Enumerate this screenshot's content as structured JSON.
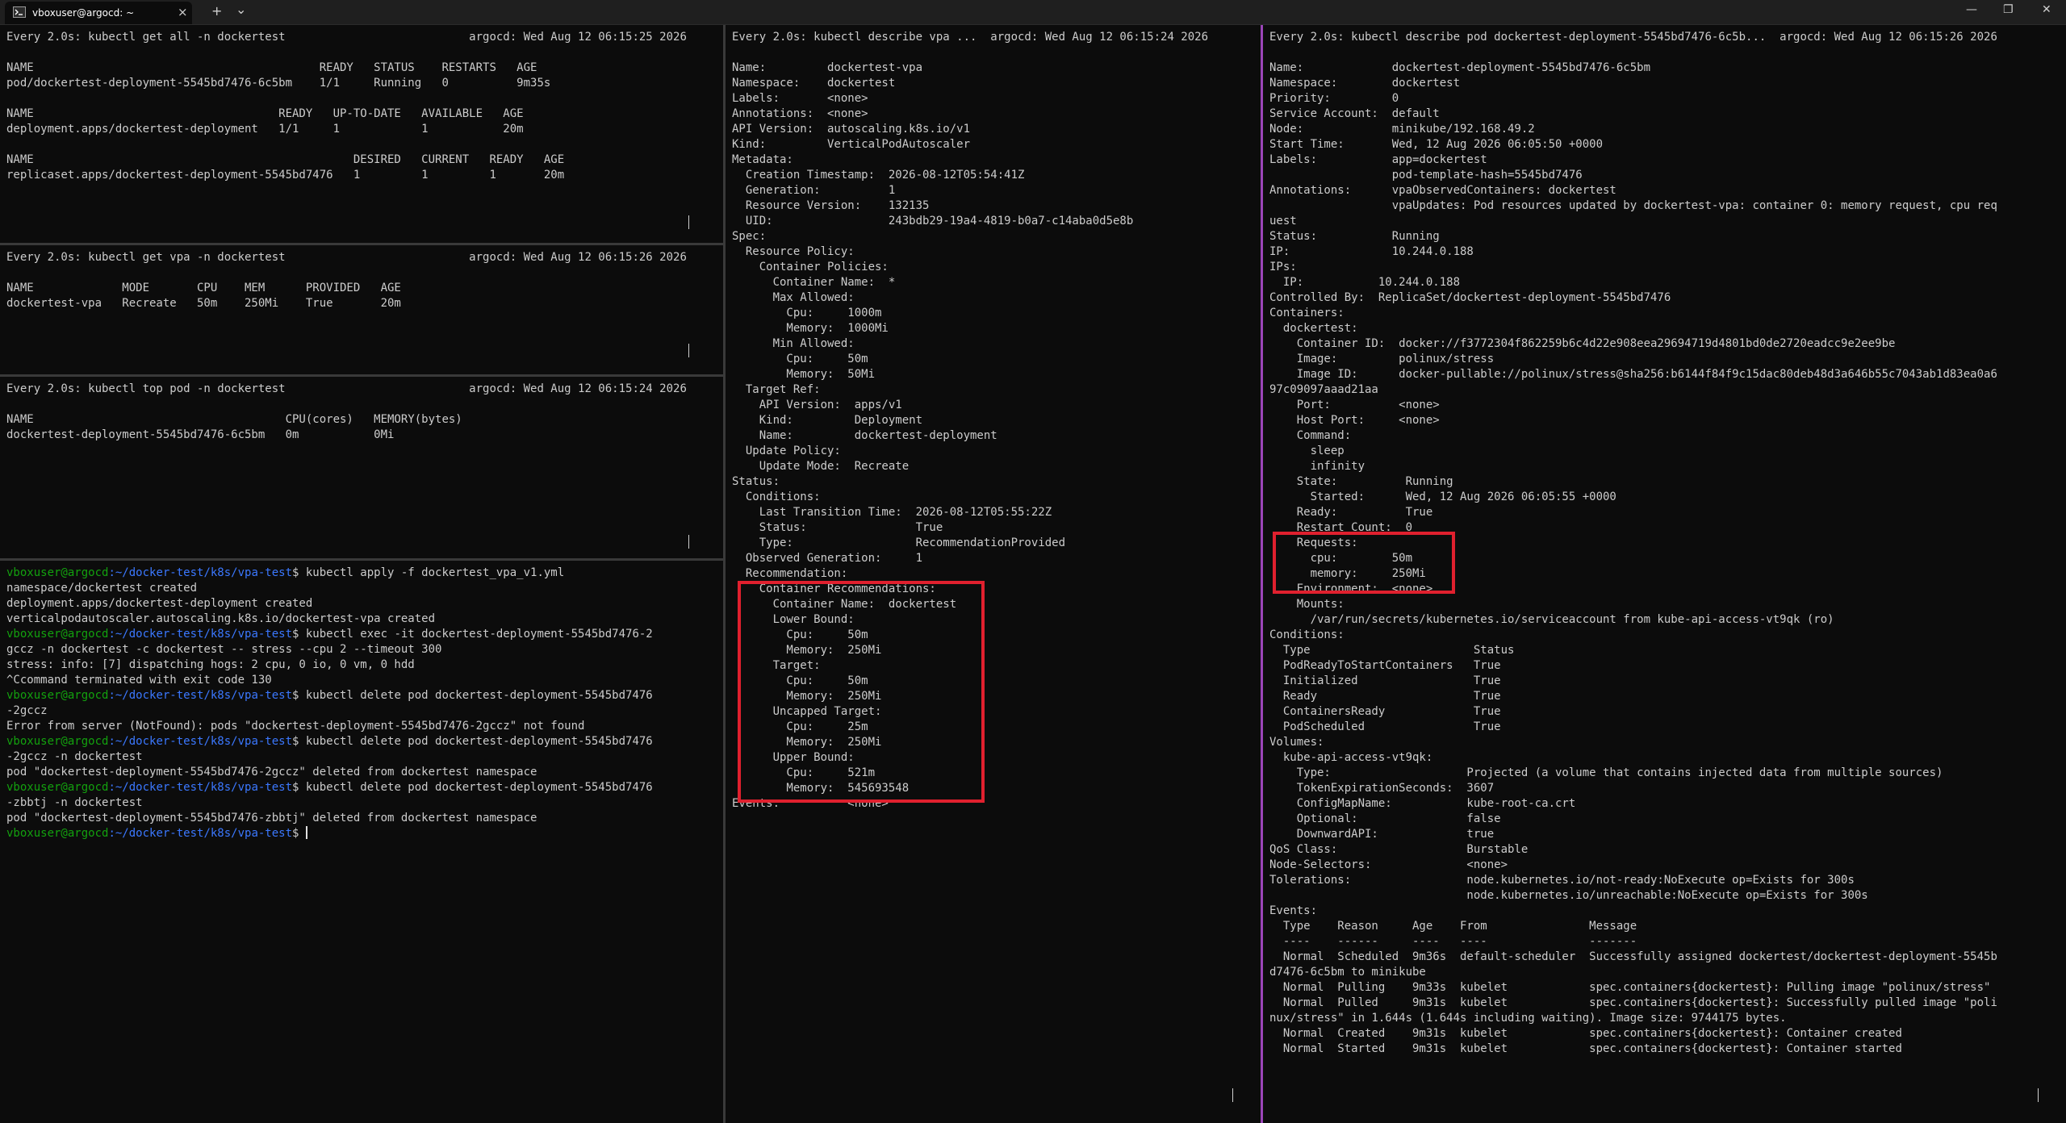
{
  "window": {
    "tab_title": "vboxuser@argocd: ~",
    "tab_close": "×",
    "new_tab": "+",
    "tab_dropdown": "⌄",
    "minimize": "—",
    "maximize": "❐",
    "close": "✕"
  },
  "pane1": {
    "text": "Every 2.0s: kubectl get all -n dockertest                           argocd: Wed Aug 12 06:15:25 2026\n\nNAME                                          READY   STATUS    RESTARTS   AGE\npod/dockertest-deployment-5545bd7476-6c5bm    1/1     Running   0          9m35s\n\nNAME                                    READY   UP-TO-DATE   AVAILABLE   AGE\ndeployment.apps/dockertest-deployment   1/1     1            1           20m\n\nNAME                                               DESIRED   CURRENT   READY   AGE\nreplicaset.apps/dockertest-deployment-5545bd7476   1         1         1       20m"
  },
  "pane2": {
    "text": "Every 2.0s: kubectl get vpa -n dockertest                           argocd: Wed Aug 12 06:15:26 2026\n\nNAME             MODE       CPU    MEM      PROVIDED   AGE\ndockertest-vpa   Recreate   50m    250Mi    True       20m"
  },
  "pane3": {
    "text": "Every 2.0s: kubectl top pod -n dockertest                           argocd: Wed Aug 12 06:15:24 2026\n\nNAME                                     CPU(cores)   MEMORY(bytes)\ndockertest-deployment-5545bd7476-6c5bm   0m           0Mi"
  },
  "shell": {
    "user": "vboxuser@argocd",
    "path": ":~/docker-test/k8s/vpa-test",
    "cmd1": "$ kubectl apply -f dockertest_vpa_v1.yml",
    "out1": "namespace/dockertest created\ndeployment.apps/dockertest-deployment created\nverticalpodautoscaler.autoscaling.k8s.io/dockertest-vpa created",
    "cmd2": "$ kubectl exec -it dockertest-deployment-5545bd7476-2\ngccz -n dockertest -c dockertest -- stress --cpu 2 --timeout 300",
    "out2": "stress: info: [7] dispatching hogs: 2 cpu, 0 io, 0 vm, 0 hdd\n^Ccommand terminated with exit code 130",
    "cmd3": "$ kubectl delete pod dockertest-deployment-5545bd7476\n-2gccz",
    "out3": "Error from server (NotFound): pods \"dockertest-deployment-5545bd7476-2gccz\" not found",
    "cmd4": "$ kubectl delete pod dockertest-deployment-5545bd7476\n-2gccz -n dockertest",
    "out4": "pod \"dockertest-deployment-5545bd7476-2gccz\" deleted from dockertest namespace",
    "cmd5": "$ kubectl delete pod dockertest-deployment-5545bd7476\n-zbbtj -n dockertest",
    "out5": "pod \"dockertest-deployment-5545bd7476-zbbtj\" deleted from dockertest namespace",
    "cmd6": "$ "
  },
  "vpa_pane": {
    "text": "Every 2.0s: kubectl describe vpa ...  argocd: Wed Aug 12 06:15:24 2026\n\nName:         dockertest-vpa\nNamespace:    dockertest\nLabels:       <none>\nAnnotations:  <none>\nAPI Version:  autoscaling.k8s.io/v1\nKind:         VerticalPodAutoscaler\nMetadata:\n  Creation Timestamp:  2026-08-12T05:54:41Z\n  Generation:          1\n  Resource Version:    132135\n  UID:                 243bdb29-19a4-4819-b0a7-c14aba0d5e8b\nSpec:\n  Resource Policy:\n    Container Policies:\n      Container Name:  *\n      Max Allowed:\n        Cpu:     1000m\n        Memory:  1000Mi\n      Min Allowed:\n        Cpu:     50m\n        Memory:  50Mi\n  Target Ref:\n    API Version:  apps/v1\n    Kind:         Deployment\n    Name:         dockertest-deployment\n  Update Policy:\n    Update Mode:  Recreate\nStatus:\n  Conditions:\n    Last Transition Time:  2026-08-12T05:55:22Z\n    Status:                True\n    Type:                  RecommendationProvided\n  Observed Generation:     1\n  Recommendation:\n    Container Recommendations:\n      Container Name:  dockertest\n      Lower Bound:\n        Cpu:     50m\n        Memory:  250Mi\n      Target:\n        Cpu:     50m\n        Memory:  250Mi\n      Uncapped Target:\n        Cpu:     25m\n        Memory:  250Mi\n      Upper Bound:\n        Cpu:     521m\n        Memory:  545693548\nEvents:          <none>"
  },
  "pod_pane": {
    "text": "Every 2.0s: kubectl describe pod dockertest-deployment-5545bd7476-6c5b...  argocd: Wed Aug 12 06:15:26 2026\n\nName:             dockertest-deployment-5545bd7476-6c5bm\nNamespace:        dockertest\nPriority:         0\nService Account:  default\nNode:             minikube/192.168.49.2\nStart Time:       Wed, 12 Aug 2026 06:05:50 +0000\nLabels:           app=dockertest\n                  pod-template-hash=5545bd7476\nAnnotations:      vpaObservedContainers: dockertest\n                  vpaUpdates: Pod resources updated by dockertest-vpa: container 0: memory request, cpu req\nuest\nStatus:           Running\nIP:               10.244.0.188\nIPs:\n  IP:           10.244.0.188\nControlled By:  ReplicaSet/dockertest-deployment-5545bd7476\nContainers:\n  dockertest:\n    Container ID:  docker://f3772304f862259b6c4d22e908eea29694719d4801bd0de2720eadcc9e2ee9be\n    Image:         polinux/stress\n    Image ID:      docker-pullable://polinux/stress@sha256:b6144f84f9c15dac80deb48d3a646b55c7043ab1d83ea0a6\n97c09097aaad21aa\n    Port:          <none>\n    Host Port:     <none>\n    Command:\n      sleep\n      infinity\n    State:          Running\n      Started:      Wed, 12 Aug 2026 06:05:55 +0000\n    Ready:          True\n    Restart Count:  0\n    Requests:\n      cpu:        50m\n      memory:     250Mi\n    Environment:  <none>\n    Mounts:\n      /var/run/secrets/kubernetes.io/serviceaccount from kube-api-access-vt9qk (ro)\nConditions:\n  Type                        Status\n  PodReadyToStartContainers   True\n  Initialized                 True\n  Ready                       True\n  ContainersReady             True\n  PodScheduled                True\nVolumes:\n  kube-api-access-vt9qk:\n    Type:                    Projected (a volume that contains injected data from multiple sources)\n    TokenExpirationSeconds:  3607\n    ConfigMapName:           kube-root-ca.crt\n    Optional:                false\n    DownwardAPI:             true\nQoS Class:                   Burstable\nNode-Selectors:              <none>\nTolerations:                 node.kubernetes.io/not-ready:NoExecute op=Exists for 300s\n                             node.kubernetes.io/unreachable:NoExecute op=Exists for 300s\nEvents:\n  Type    Reason     Age    From               Message\n  ----    ------     ----   ----               -------\n  Normal  Scheduled  9m36s  default-scheduler  Successfully assigned dockertest/dockertest-deployment-5545b\nd7476-6c5bm to minikube\n  Normal  Pulling    9m33s  kubelet            spec.containers{dockertest}: Pulling image \"polinux/stress\"\n  Normal  Pulled     9m31s  kubelet            spec.containers{dockertest}: Successfully pulled image \"poli\nnux/stress\" in 1.644s (1.644s including waiting). Image size: 9744175 bytes.\n  Normal  Created    9m31s  kubelet            spec.containers{dockertest}: Container created\n  Normal  Started    9m31s  kubelet            spec.containers{dockertest}: Container started"
  }
}
